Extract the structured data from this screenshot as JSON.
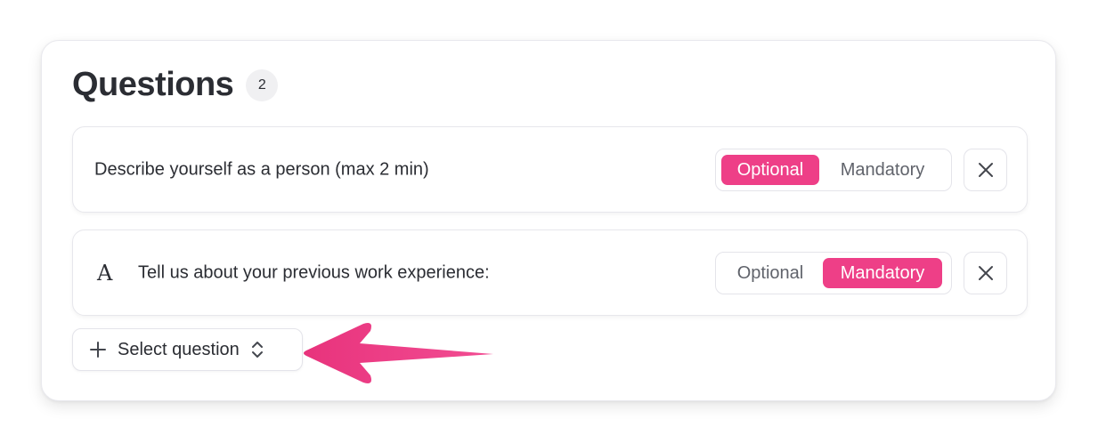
{
  "header": {
    "title": "Questions",
    "count": "2"
  },
  "questions": [
    {
      "text": "Describe yourself as a person (max 2 min)",
      "type_icon": "",
      "requirement": "Optional"
    },
    {
      "text": "Tell us about your previous work experience:",
      "type_icon": "A",
      "requirement": "Mandatory"
    }
  ],
  "toggle": {
    "optional_label": "Optional",
    "mandatory_label": "Mandatory"
  },
  "select": {
    "label": "Select question"
  },
  "icons": {
    "close": "close-icon",
    "plus": "plus-icon",
    "chevron": "chevron-up-down-icon",
    "type": "text-type-icon",
    "arrow": "arrow-left-annotation"
  },
  "colors": {
    "accent": "#ee3f87",
    "text": "#2b2d33",
    "muted": "#60636b",
    "border": "#e4e4ea"
  }
}
